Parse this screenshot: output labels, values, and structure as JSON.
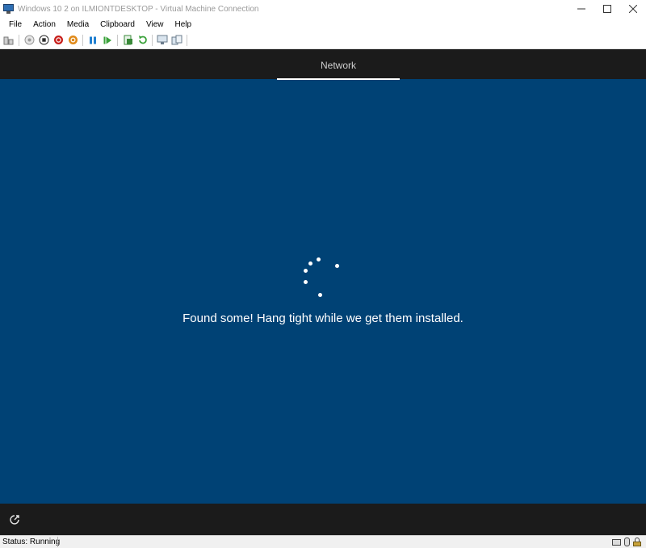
{
  "window": {
    "title": "Windows 10 2 on ILMIONTDESKTOP - Virtual Machine Connection",
    "controls": [
      "minimize-icon",
      "maximize-icon",
      "close-icon"
    ]
  },
  "menu": {
    "items": [
      "File",
      "Action",
      "Media",
      "Clipboard",
      "View",
      "Help"
    ]
  },
  "toolbar": {
    "buttons": [
      {
        "name": "ctrl-alt-del-icon",
        "color": "#7a7a7a"
      },
      {
        "name": "start-icon",
        "color": "#9a9a9a"
      },
      {
        "name": "turn-off-icon",
        "color": "#2b2b2b"
      },
      {
        "name": "shut-down-icon",
        "color": "#c8201c"
      },
      {
        "name": "save-icon",
        "color": "#e08a1a"
      },
      {
        "name": "pause-icon",
        "color": "#1f7fd0"
      },
      {
        "name": "resume-icon",
        "color": "#3aa13a"
      },
      {
        "name": "checkpoint-icon",
        "color": "#3a8a3a"
      },
      {
        "name": "revert-icon",
        "color": "#3aa13a"
      },
      {
        "name": "enhanced-session-icon",
        "color": "#6b7c8c"
      },
      {
        "name": "share-icon",
        "color": "#6b7c8c"
      }
    ]
  },
  "vm": {
    "colors": {
      "background": "#004275",
      "band": "#1b1b1b"
    },
    "tab_label": "Network",
    "message": "Found some! Hang tight while we get them installed.",
    "bottom_icon": "ease-of-access-icon"
  },
  "statusbar": {
    "status": "Status: Running",
    "tray_icons": [
      "keyboard-icon",
      "mouse-icon",
      "lock-icon"
    ]
  }
}
